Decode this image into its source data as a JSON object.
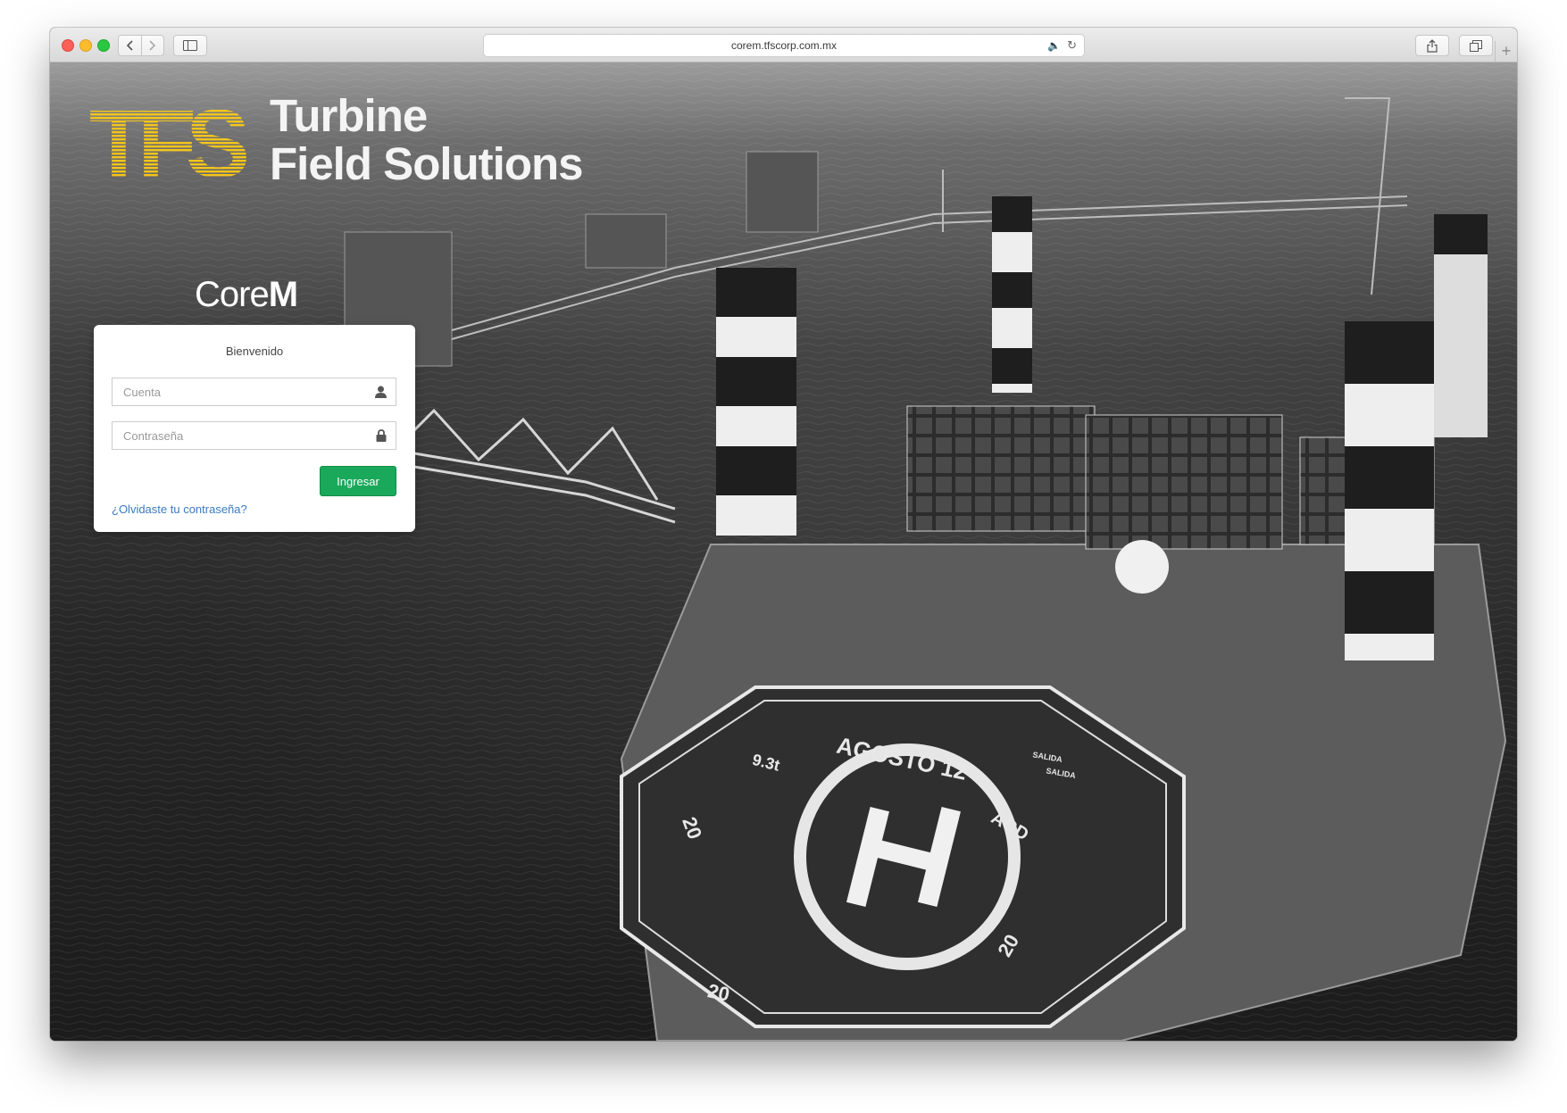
{
  "browser": {
    "url": "corem.tfscorp.com.mx",
    "new_tab": "+"
  },
  "brand": {
    "logo_letters": "TFS",
    "line1": "Turbine",
    "line2": "Field Solutions",
    "accent_color": "#f5c61a"
  },
  "app": {
    "name_light": "Core",
    "name_bold": "M"
  },
  "login": {
    "welcome": "Bienvenido",
    "account_placeholder": "Cuenta",
    "password_placeholder": "Contraseña",
    "submit_label": "Ingresar",
    "forgot_link": "¿Olvidaste tu contraseña?",
    "submit_color": "#1aa85a"
  },
  "background": {
    "heliport_labels": [
      "AGOSTO 12",
      "9.3t",
      "AGD",
      "20",
      "20",
      "20",
      "H",
      "SALIDA",
      "SALIDA"
    ]
  }
}
